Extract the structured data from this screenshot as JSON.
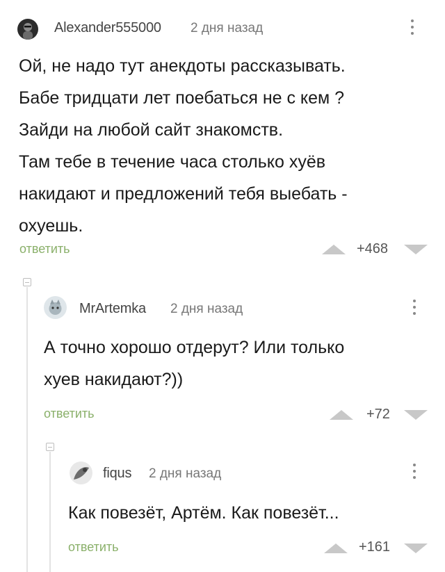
{
  "comments": [
    {
      "author": "Alexander555000",
      "time": "2 дня назад",
      "lines": [
        "Ой, не надо тут анекдоты рассказывать.",
        "Бабе тридцати лет поебаться не с кем ?",
        "Зайди на любой сайт знакомств.",
        "Там тебе в течение часа столько хуёв",
        "накидают и предложений тебя выебать -",
        "охуешь."
      ],
      "reply_label": "ответить",
      "rating": "+468"
    },
    {
      "author": "MrArtemka",
      "time": "2 дня назад",
      "lines": [
        "А точно хорошо отдерут? Или только",
        "хуев накидают?))"
      ],
      "reply_label": "ответить",
      "rating": "+72"
    },
    {
      "author": "fiqus",
      "time": "2 дня назад",
      "lines": [
        "Как повезёт, Артём. Как повезёт..."
      ],
      "reply_label": "ответить",
      "rating": "+161"
    }
  ],
  "icons": {
    "upvote": "triangle-up-icon",
    "downvote": "triangle-down-icon",
    "more": "vertical-dots-icon",
    "collapse": "collapse-minus-icon"
  },
  "colors": {
    "reply": "#8ab06a",
    "vote_arrow": "#c8c8c8",
    "thread_line": "#e3e3e3"
  }
}
